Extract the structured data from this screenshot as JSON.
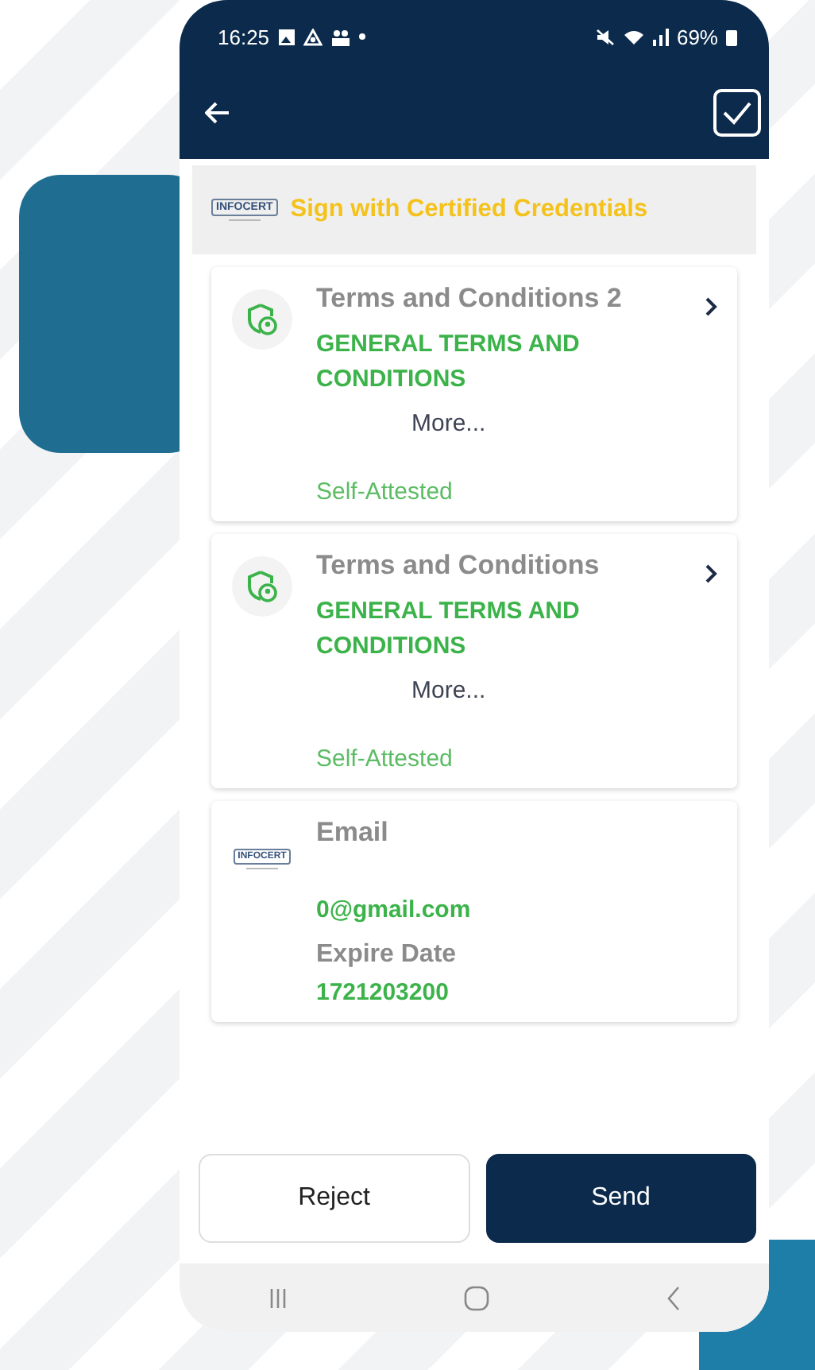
{
  "status_bar": {
    "time": "16:25",
    "battery": "69%"
  },
  "banner": {
    "logo": "INFOCERT",
    "title": "Sign with Certified Credentials"
  },
  "credentials": [
    {
      "kind": "shield",
      "title": "Terms and Conditions 2",
      "value": "GENERAL TERMS AND CONDITIONS",
      "more": "More...",
      "source": "Self-Attested"
    },
    {
      "kind": "shield",
      "title": "Terms and Conditions",
      "value": "GENERAL TERMS AND CONDITIONS",
      "more": "More...",
      "source": "Self-Attested"
    },
    {
      "kind": "logo",
      "logo": "INFOCERT",
      "title": "Email",
      "value": "0@gmail.com",
      "fields": [
        {
          "label": "Expire Date",
          "value": "1721203200"
        }
      ]
    }
  ],
  "actions": [
    {
      "label": "Reject",
      "kind": "secondary"
    },
    {
      "label": "Send",
      "kind": "primary"
    }
  ]
}
